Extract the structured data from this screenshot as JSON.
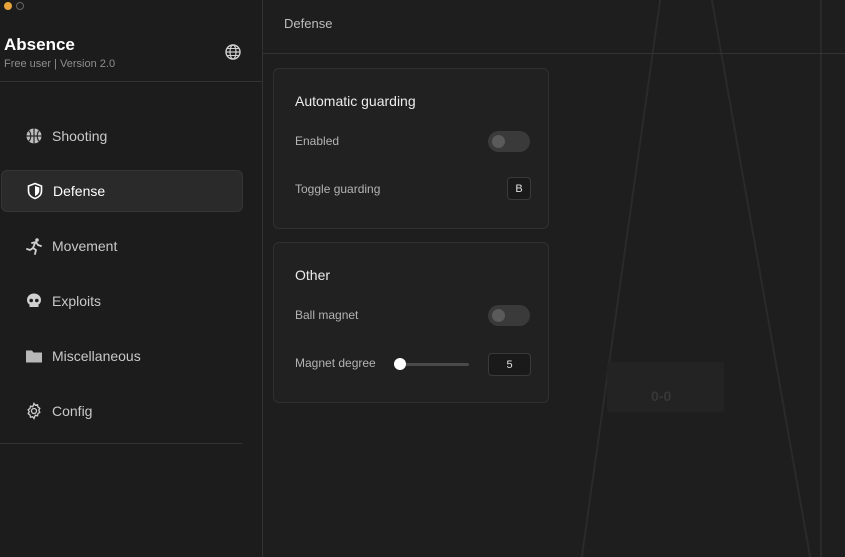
{
  "app": {
    "name": "Absence",
    "subtitle": "Free user | Version 2.0"
  },
  "sidebar": {
    "items": [
      {
        "label": "Shooting",
        "icon": "basketball-icon",
        "active": false
      },
      {
        "label": "Defense",
        "icon": "shield-icon",
        "active": true
      },
      {
        "label": "Movement",
        "icon": "running-icon",
        "active": false
      },
      {
        "label": "Exploits",
        "icon": "skull-icon",
        "active": false
      },
      {
        "label": "Miscellaneous",
        "icon": "folder-icon",
        "active": false
      },
      {
        "label": "Config",
        "icon": "gear-icon",
        "active": false
      }
    ]
  },
  "main": {
    "title": "Defense",
    "guarding": {
      "title": "Automatic guarding",
      "enabled_label": "Enabled",
      "enabled_value": false,
      "toggle_label": "Toggle guarding",
      "toggle_key": "B"
    },
    "other": {
      "title": "Other",
      "ball_magnet_label": "Ball magnet",
      "ball_magnet_value": false,
      "magnet_degree_label": "Magnet degree",
      "magnet_degree_value": "5",
      "magnet_degree_fraction": 0.0
    }
  },
  "colors": {
    "background": "#1e1e1e",
    "accent_dot": "#e8a33a",
    "text": "#e6e6e6"
  }
}
